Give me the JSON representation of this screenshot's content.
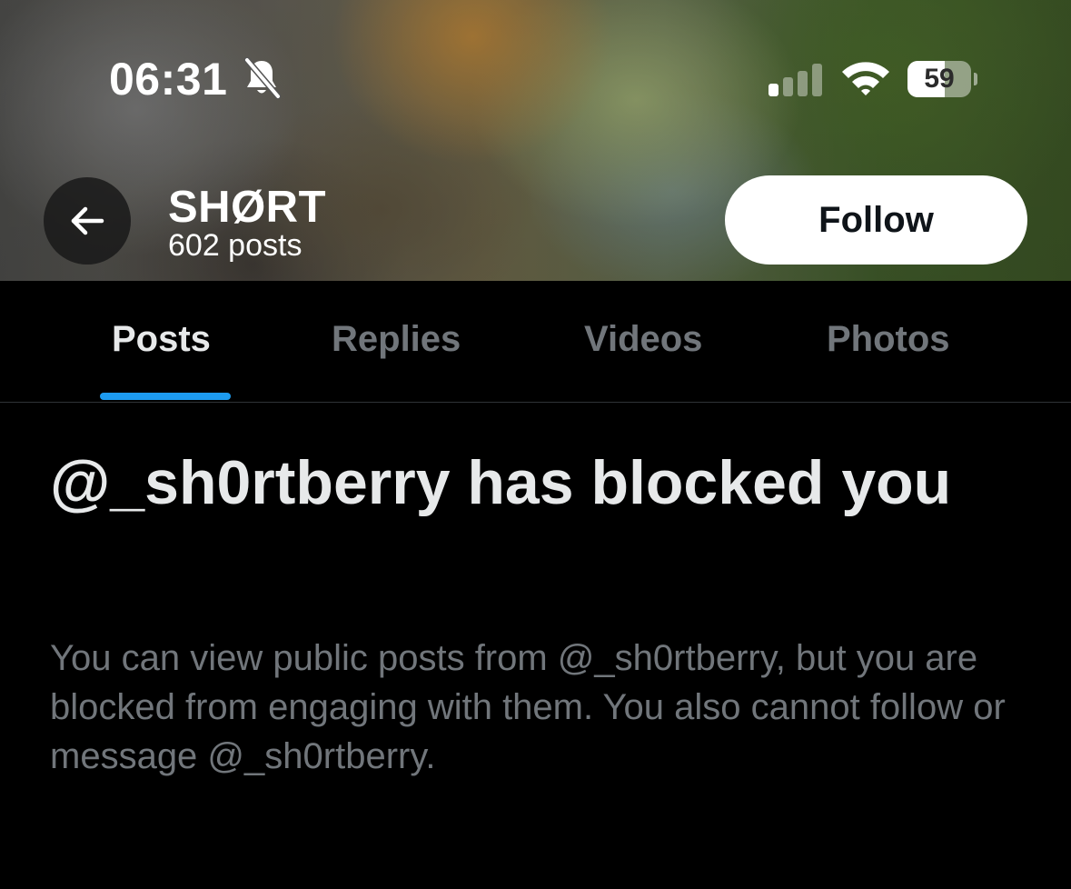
{
  "status_bar": {
    "time": "06:31",
    "battery_level": "59",
    "battery_fraction": 0.59,
    "icons": [
      "bell-slash-icon",
      "cellular-signal-icon",
      "wifi-icon",
      "battery-icon"
    ]
  },
  "header": {
    "back_icon": "arrow-left-icon",
    "profile_name": "SHØRT",
    "post_count": "602 posts",
    "follow_label": "Follow"
  },
  "tabs": [
    {
      "label": "Posts",
      "active": true
    },
    {
      "label": "Replies",
      "active": false
    },
    {
      "label": "Videos",
      "active": false
    },
    {
      "label": "Photos",
      "active": false
    }
  ],
  "blocked_notice": {
    "title": "@_sh0rtberry has blocked you",
    "body": "You can view public posts from @_sh0rtberry, but you are blocked from engaging with them. You also cannot follow or message @_sh0rtberry."
  },
  "colors": {
    "background": "#000000",
    "accent": "#1d9bf0",
    "primary_text": "#e7e9ea",
    "secondary_text": "#71767b",
    "follow_button_bg": "#ffffff"
  }
}
